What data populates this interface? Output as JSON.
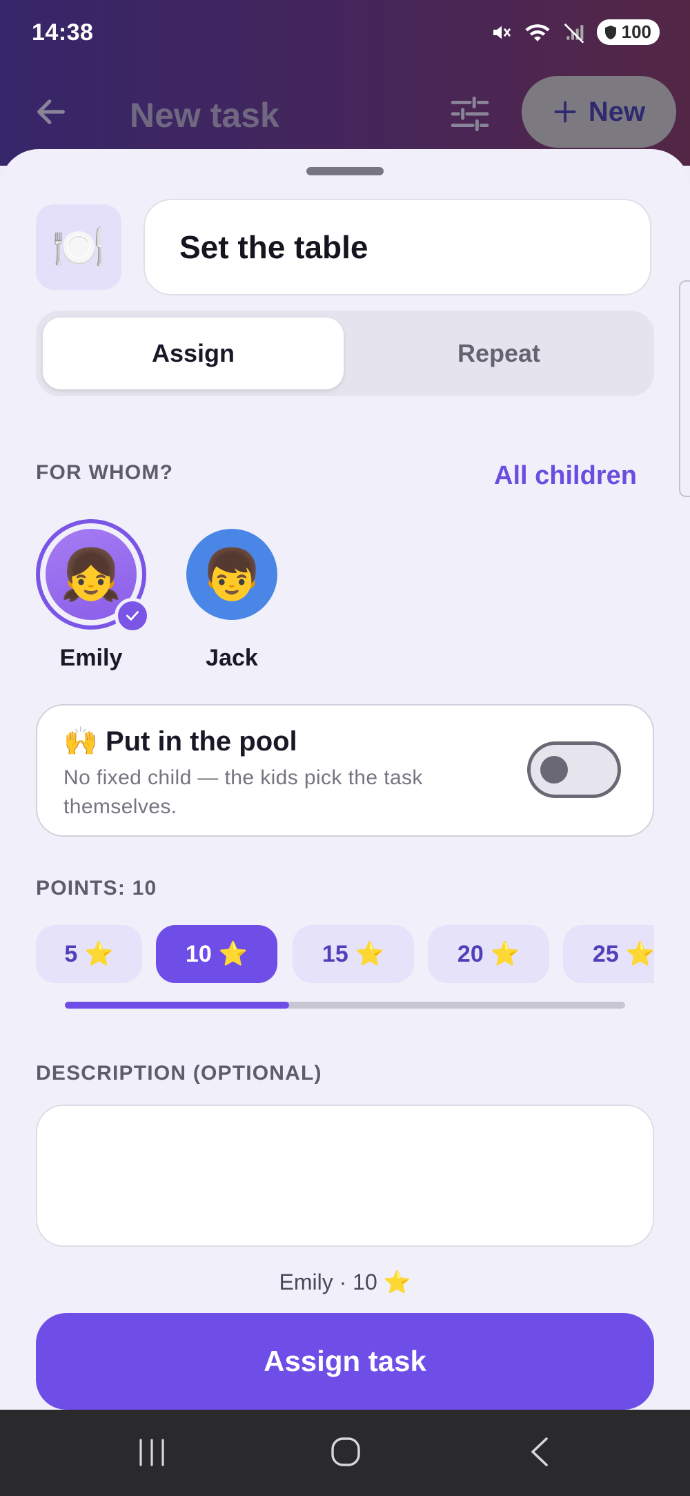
{
  "status": {
    "time": "14:38",
    "battery": "100"
  },
  "appbar": {
    "title": "New task",
    "new_label": "New"
  },
  "task": {
    "emoji": "🍽️",
    "name": "Set the table"
  },
  "tabs": [
    {
      "label": "Assign",
      "active": true
    },
    {
      "label": "Repeat",
      "active": false
    }
  ],
  "for_whom": {
    "label": "FOR WHOM?",
    "all_children_label": "All children",
    "children": [
      {
        "name": "Emily",
        "emoji": "👧",
        "selected": true,
        "color": "#9b6cf0"
      },
      {
        "name": "Jack",
        "emoji": "👦",
        "selected": false,
        "color": "#4a86e6"
      }
    ]
  },
  "pool": {
    "emoji": "🙌",
    "title": "Put in the pool",
    "description": "No fixed child — the kids pick the task themselves.",
    "enabled": false
  },
  "points": {
    "label": "POINTS: 10",
    "options": [
      "5",
      "10",
      "15",
      "20",
      "25"
    ],
    "selected": "10",
    "star": "⭐",
    "scroll_position": 0.4
  },
  "description": {
    "label": "DESCRIPTION (OPTIONAL)",
    "value": "",
    "placeholder": ""
  },
  "summary": {
    "child": "Emily",
    "separator": "·",
    "points": "10",
    "star": "⭐"
  },
  "submit_label": "Assign task",
  "colors": {
    "accent": "#6f4ee8",
    "sheet_bg": "#f1f0fa"
  }
}
